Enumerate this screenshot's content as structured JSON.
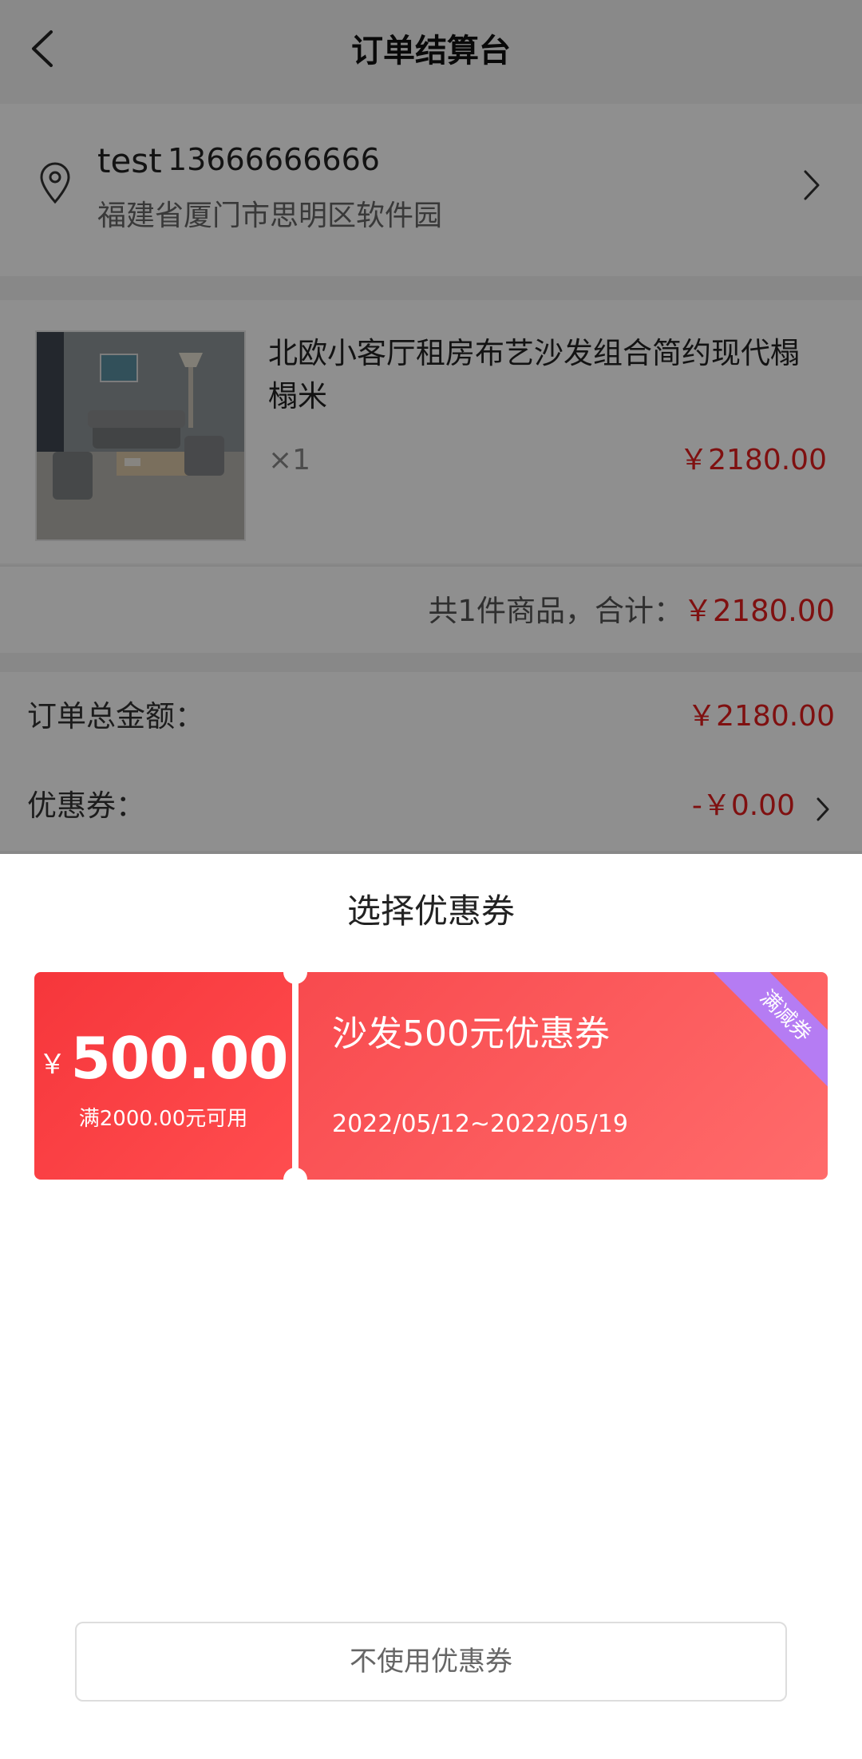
{
  "header": {
    "title": "订单结算台",
    "back_icon": "back-arrow-icon"
  },
  "address": {
    "name": "test",
    "phone": "13666666666",
    "detail": "福建省厦门市思明区软件园",
    "icon": "location-pin-icon"
  },
  "product": {
    "title": "北欧小客厅租房布艺沙发组合简约现代榻榻米",
    "quantity": "×1",
    "price": "￥2180.00"
  },
  "subtotal": {
    "label": "共1件商品，合计：",
    "amount": "￥2180.00"
  },
  "summary": {
    "order_total_label": "订单总金额：",
    "order_total_value": "￥2180.00",
    "coupon_label": "优惠券：",
    "coupon_value": "-￥0.00"
  },
  "coupon_sheet": {
    "title": "选择优惠券",
    "coupons": [
      {
        "currency": "￥",
        "amount": "500.00",
        "condition": "满2000.00元可用",
        "name": "沙发500元优惠券",
        "dates": "2022/05/12~2022/05/19",
        "tag": "满减券"
      }
    ],
    "no_coupon_label": "不使用优惠券"
  },
  "colors": {
    "price_red": "#e21d1d",
    "coupon_red": "#f6363b",
    "tag_purple": "#b57cf3",
    "overlay": "rgba(0,0,0,0.44)"
  }
}
